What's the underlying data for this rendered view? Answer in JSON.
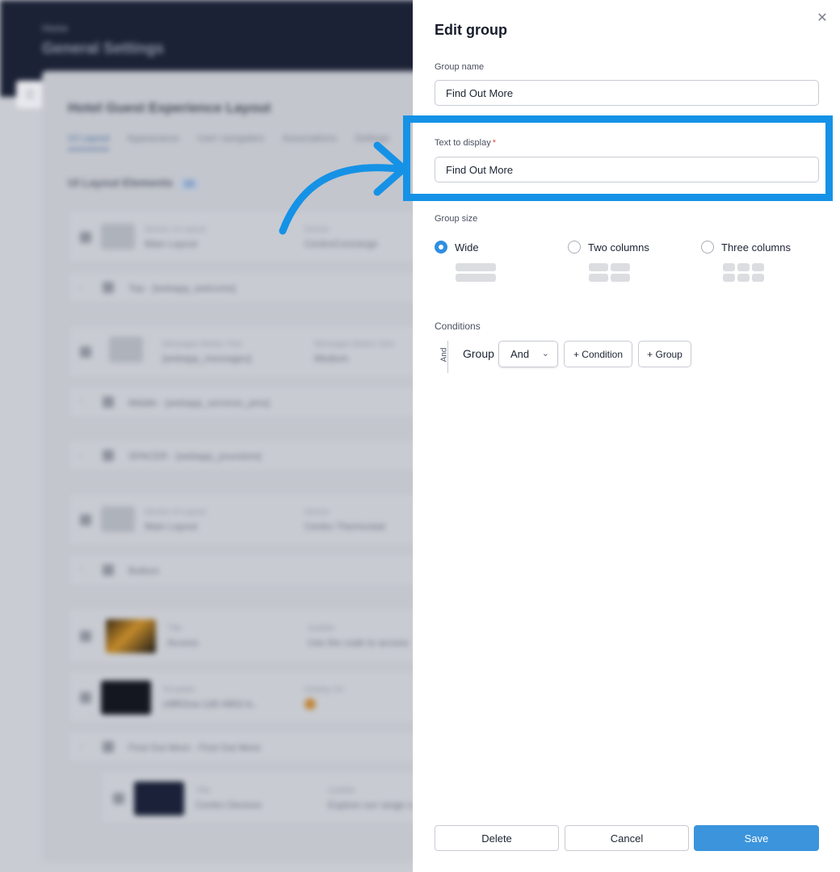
{
  "background": {
    "breadcrumb": "Home",
    "page_title": "General Settings",
    "card_title": "Hotel Guest Experience Layout",
    "tabs": [
      "UI Layout",
      "Appearance",
      "User navigation",
      "Associations",
      "Settings"
    ],
    "section_title": "UI Layout Elements",
    "section_count": "15",
    "rows": [
      {
        "label1": "Device UI Layout",
        "value1": "Main Layout",
        "label2": "Device",
        "value2": "CentroConcierge"
      },
      {
        "group": "Top - [webapp_welcome]"
      },
      {
        "label1": "Messages Button Text",
        "value1": "[webapp_messages]",
        "label2": "Messages Button Size",
        "value2": "Medium"
      },
      {
        "group": "Middle - [webapp_services_pms]"
      },
      {
        "group": "SPACER - [webapp_yourstore]"
      },
      {
        "label1": "Device UI Layout",
        "value1": "Main Layout",
        "label2": "Device",
        "value2": "Centro Thermostat"
      },
      {
        "group": "Bottom"
      },
      {
        "label1": "Title",
        "value1": "Access",
        "label2": "Subtitle",
        "value2": "Use the code to access"
      },
      {
        "label1": "Template",
        "value1": "c6ff02ea-1d0-4902-b..",
        "label2": "Display On",
        "value2": ""
      },
      {
        "group": "Find Out More - Find Out More"
      },
      {
        "label1": "Title",
        "value1": "Centro Devices",
        "label2": "Subtitle",
        "value2": "Explore our range o"
      }
    ]
  },
  "panel": {
    "title": "Edit group",
    "close_icon": "close-icon",
    "group_name": {
      "label": "Group name",
      "value": "Find Out More"
    },
    "text_to_display": {
      "label": "Text to display",
      "required_mark": "*",
      "value": "Find Out More"
    },
    "group_size": {
      "label": "Group size",
      "options": [
        {
          "label": "Wide",
          "checked": true
        },
        {
          "label": "Two columns",
          "checked": false
        },
        {
          "label": "Three columns",
          "checked": false
        }
      ]
    },
    "conditions": {
      "label": "Conditions",
      "operator_vertical": "And",
      "group_label": "Group",
      "operator_select": "And",
      "add_condition": "+ Condition",
      "add_group": "+ Group"
    },
    "footer": {
      "delete": "Delete",
      "cancel": "Cancel",
      "save": "Save"
    }
  },
  "annotation": {
    "color": "#1592e6"
  },
  "colors": {
    "accent": "#3b94dc",
    "header": "#1c2236",
    "required": "#e14b3b"
  }
}
